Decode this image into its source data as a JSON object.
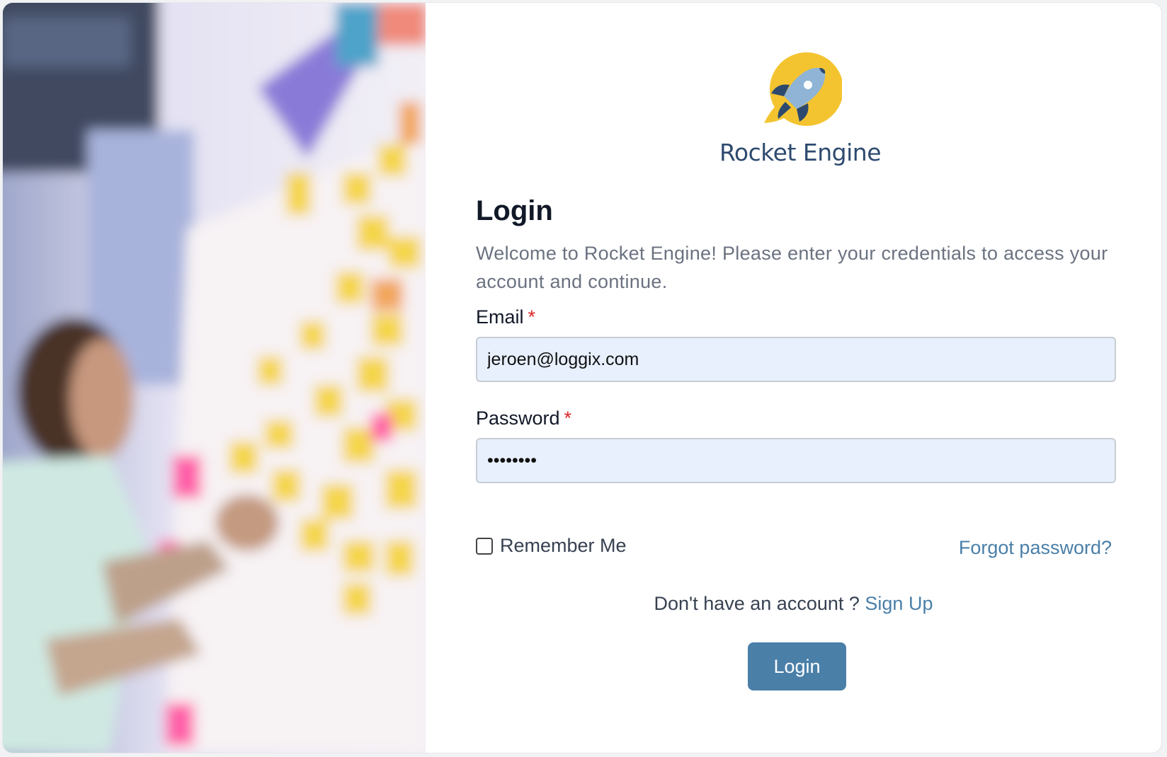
{
  "brand": {
    "name": "Rocket Engine",
    "logo_icon": "rocket-icon",
    "accent": "#f4c430",
    "primary": "#2d4a6e"
  },
  "hero": {
    "image": "blurred photo of a person writing on a wall of sticky notes"
  },
  "form": {
    "title": "Login",
    "subtitle": "Welcome to Rocket Engine! Please enter your credentials to access your account and continue.",
    "email": {
      "label": "Email",
      "required_mark": "*",
      "value": "jeroen@loggix.com"
    },
    "password": {
      "label": "Password",
      "required_mark": "*",
      "value": "••••••••"
    },
    "remember": {
      "label": "Remember Me",
      "checked": false
    },
    "forgot_label": "Forgot password?",
    "signup_prompt": "Don't have an account ?",
    "signup_label": "Sign Up",
    "submit_label": "Login",
    "button_color": "#4a7fa8",
    "required_color": "#dc2626"
  }
}
